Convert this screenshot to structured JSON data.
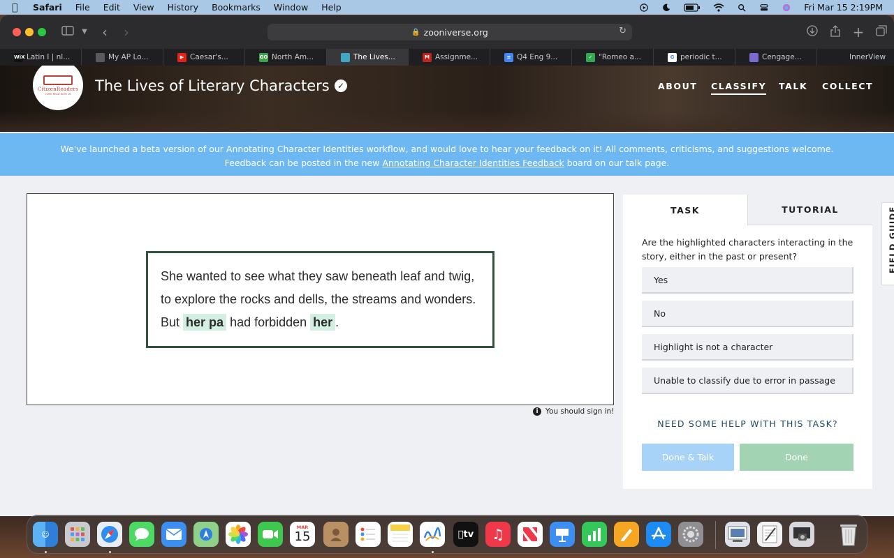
{
  "menubar": {
    "app": "Safari",
    "items": [
      "File",
      "Edit",
      "View",
      "History",
      "Bookmarks",
      "Window",
      "Help"
    ],
    "clock": "Fri Mar 15  2:19PM"
  },
  "browser": {
    "url": "zooniverse.org",
    "tabs": [
      {
        "label": "Latin I | nl...",
        "fav": "WiX",
        "color": "#111111"
      },
      {
        "label": "My AP Lo...",
        "fav": "",
        "color": "#5a5a5a"
      },
      {
        "label": "Caesar's...",
        "fav": "▶",
        "color": "#e62117"
      },
      {
        "label": "North Am...",
        "fav": "GO",
        "color": "#3aa34a"
      },
      {
        "label": "The Lives...",
        "fav": "",
        "color": "#43a6c4",
        "active": true
      },
      {
        "label": "Assignme...",
        "fav": "M",
        "color": "#c5221f"
      },
      {
        "label": "Q4 Eng 9...",
        "fav": "≡",
        "color": "#4285f4"
      },
      {
        "label": "\"Romeo a...",
        "fav": "✓",
        "color": "#34a853"
      },
      {
        "label": "periodic t...",
        "fav": "G",
        "color": "#ffffff"
      },
      {
        "label": "Cengage...",
        "fav": "",
        "color": "#7b6ad0"
      }
    ],
    "last_tab": "InnerView"
  },
  "header": {
    "logo_name": "CitizenReaders",
    "logo_tagline": "COME READ WITH US",
    "title": "The Lives of Literary Characters",
    "nav": [
      "ABOUT",
      "CLASSIFY",
      "TALK",
      "COLLECT"
    ]
  },
  "banner": {
    "line1": "We've launched a beta version of our Annotating Character Identities workflow, and would love to hear your feedback on it! All comments, criticisms, and suggestions welcome.",
    "line2_pre": "Feedback can be posted in the new ",
    "line2_link": "Annotating Character Identities Feedback",
    "line2_post": " board on our talk page."
  },
  "passage": {
    "text1": "She wanted to see what they saw beneath leaf and twig, to explore the rocks and dells, the streams and wonders. But ",
    "hl1": "her pa",
    "text2": " had forbidden ",
    "hl2": "her",
    "text3": "."
  },
  "signin": "You should sign in!",
  "task": {
    "tab_task": "TASK",
    "tab_tutorial": "TUTORIAL",
    "question": "Are the highlighted characters interacting in the story, either in the past or present?",
    "answers": [
      "Yes",
      "No",
      "Highlight is not a character",
      "Unable to classify due to error in passage"
    ],
    "help": "NEED SOME HELP WITH THIS TASK?",
    "done_talk": "Done & Talk",
    "done": "Done"
  },
  "field_guide": "FIELD GUIDE",
  "dock": {
    "calendar_month": "MAR",
    "calendar_day": "15"
  }
}
